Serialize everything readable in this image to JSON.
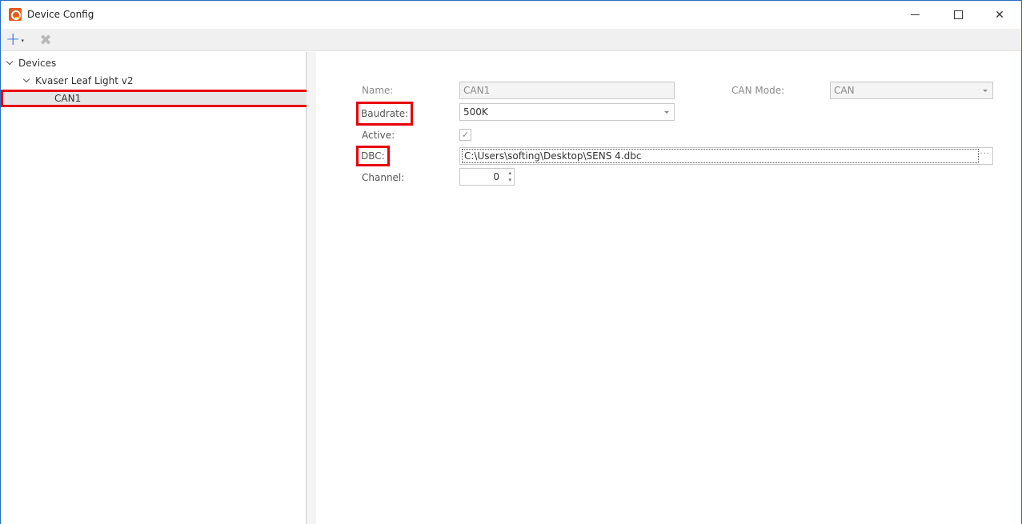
{
  "window": {
    "title": "Device Config",
    "app_icon": "app-logo-icon",
    "controls": {
      "minimize": "minimize-icon",
      "maximize": "maximize-icon",
      "close_glyph": "✕"
    }
  },
  "toolbar": {
    "add_glyph": "+",
    "add_caret": "▾",
    "delete_glyph": "✖"
  },
  "tree": {
    "root": "Devices",
    "device": "Kvaser Leaf Light v2",
    "channel": "CAN1"
  },
  "form": {
    "name_label": "Name:",
    "name_value": "CAN1",
    "can_mode_label": "CAN Mode:",
    "can_mode_value": "CAN",
    "baudrate_label": "Baudrate:",
    "baudrate_value": "500K",
    "active_label": "Active:",
    "active_checked": true,
    "active_glyph": "✓",
    "dbc_label": "DBC:",
    "dbc_value": "C:\\Users\\softing\\Desktop\\SENS 4.dbc",
    "dbc_browse": "···",
    "channel_label": "Channel:",
    "channel_value": "0",
    "spin_up": "▴",
    "spin_down": "▾"
  },
  "colors": {
    "highlight": "#e8000b",
    "accent": "#1e6fd9",
    "window_border": "#2b6cc4"
  }
}
